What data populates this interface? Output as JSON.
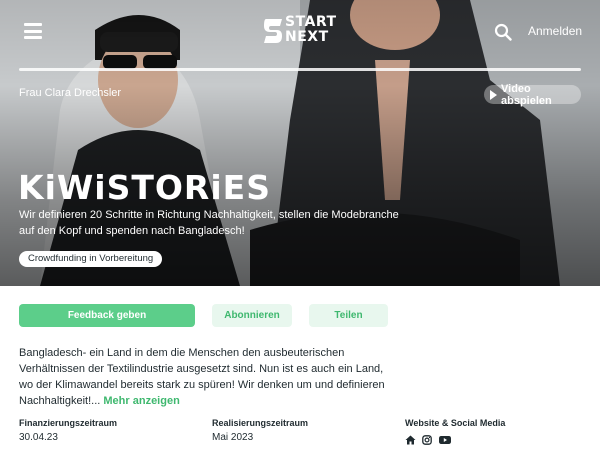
{
  "header": {
    "logo_line1": "START",
    "logo_line2": "NEXT",
    "login_label": "Anmelden",
    "icons": [
      "menu-icon",
      "search-icon"
    ]
  },
  "hero": {
    "owner": "Frau Clara Drechsler",
    "video_label": "Video abspielen",
    "title": "KiWiSTORiES",
    "description": "Wir definieren 20 Schritte in Richtung Nachhaltigkeit, stellen die Modebranche auf den Kopf und spenden nach Bangladesch!",
    "status": "Crowdfunding in Vorbereitung"
  },
  "actions": {
    "feedback": "Feedback geben",
    "subscribe": "Abonnieren",
    "share": "Teilen"
  },
  "about": {
    "text": "Bangladesch- ein Land in dem die Menschen den ausbeuterischen Verhältnissen der Textilindustrie ausgesetzt sind. Nun ist es auch ein Land, wo der Klimawandel bereits stark zu spüren! Wir denken um und definieren Nachhaltigkeit!...",
    "more": "Mehr anzeigen"
  },
  "facts": {
    "funding_label": "Finanzierungszeitraum",
    "funding_value": "30.04.23",
    "realization_label": "Realisierungszeitraum",
    "realization_value": "Mai 2023",
    "web_label": "Website & Social Media",
    "social_icons": [
      "home-icon",
      "instagram-icon",
      "youtube-icon"
    ]
  },
  "colors": {
    "accent": "#5cce8a",
    "accent_light": "#e8f7ee",
    "accent_text": "#3fb86f"
  }
}
